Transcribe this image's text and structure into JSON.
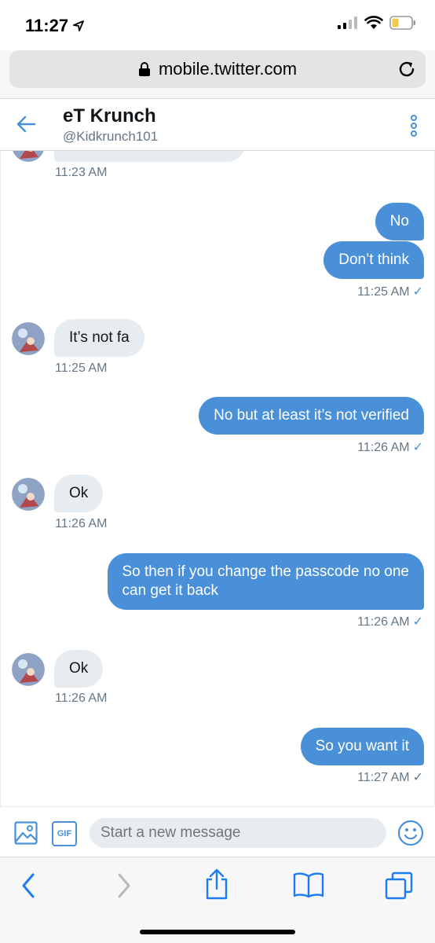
{
  "status": {
    "time": "11:27"
  },
  "browser": {
    "url": "mobile.twitter.com"
  },
  "header": {
    "name": "eT Krunch",
    "handle": "@Kidkrunch101"
  },
  "messages": [
    {
      "dir": "in",
      "text": "",
      "time": "11:23 AM"
    },
    {
      "dir": "out",
      "text": "No",
      "time": ""
    },
    {
      "dir": "out",
      "text": "Don’t think",
      "time": "11:25 AM"
    },
    {
      "dir": "in",
      "text": "It’s not fa",
      "time": "11:25 AM"
    },
    {
      "dir": "out",
      "text": "No but at least it’s not verified",
      "time": "11:26 AM"
    },
    {
      "dir": "in",
      "text": "Ok",
      "time": "11:26 AM"
    },
    {
      "dir": "out",
      "text_line1": "So then if you change the passcode no one",
      "text_line2": "can get it back",
      "time": "11:26 AM"
    },
    {
      "dir": "in",
      "text": "Ok",
      "time": "11:26 AM"
    },
    {
      "dir": "out",
      "text": "So you want it",
      "time": "11:27 AM"
    }
  ],
  "composer": {
    "placeholder": "Start a new message",
    "gif_label": "GIF"
  },
  "check": "✓",
  "colors": {
    "accent": "#4a90d9",
    "incoming_bubble": "#e6ecf0",
    "muted": "#657786"
  }
}
